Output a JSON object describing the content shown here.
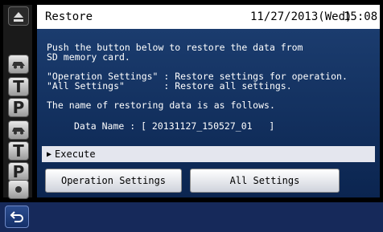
{
  "header": {
    "title": "Restore",
    "date": "11/27/2013(Wed)",
    "time": "15:08"
  },
  "main": {
    "lines": [
      "Push the button below to restore the data from",
      "SD memory card.",
      "\"Operation Settings\" : Restore settings for operation.",
      "\"All Settings\"       : Restore all settings.",
      "The name of restoring data is as follows.",
      "Data Name : [ 20131127_150527_01   ]"
    ],
    "execute_label": "Execute",
    "buttons": {
      "operation_settings": "Operation Settings",
      "all_settings": "All Settings"
    }
  },
  "rail": {
    "icons": [
      "eject-icon",
      "car-icon",
      "T",
      "P",
      "car-icon",
      "T",
      "P",
      "dot-icon"
    ]
  },
  "colors": {
    "panel": "#1b3c6e",
    "header_bg": "#ffffff",
    "footer": "#16295a"
  }
}
